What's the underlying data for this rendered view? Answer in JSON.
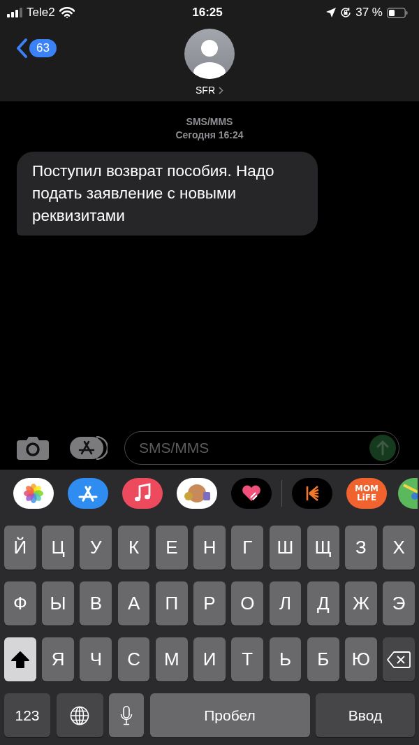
{
  "status_bar": {
    "carrier": "Tele2",
    "time": "16:25",
    "battery_percent": "37 %"
  },
  "header": {
    "back_count": "63",
    "contact_name": "SFR"
  },
  "conversation": {
    "service_label": "SMS/MMS",
    "timestamp": "Сегодня 16:24",
    "messages": [
      {
        "kind": "incoming",
        "text": "Поступил возврат пособия. Надо подать заявление с новыми реквизитами"
      }
    ]
  },
  "composer": {
    "placeholder": "SMS/MMS"
  },
  "app_strip": [
    {
      "kind": "photos"
    },
    {
      "kind": "appstore"
    },
    {
      "kind": "music"
    },
    {
      "kind": "stickers"
    },
    {
      "kind": "heart"
    },
    {
      "kind": "divider"
    },
    {
      "kind": "fan"
    },
    {
      "kind": "logo",
      "label": "MOM LiFE"
    },
    {
      "kind": "maps"
    }
  ],
  "keyboard": {
    "letter_rows": [
      [
        {
          "kind": "letter",
          "label": "Й"
        },
        {
          "kind": "letter",
          "label": "Ц"
        },
        {
          "kind": "letter",
          "label": "У"
        },
        {
          "kind": "letter",
          "label": "К"
        },
        {
          "kind": "letter",
          "label": "Е"
        },
        {
          "kind": "letter",
          "label": "Н"
        },
        {
          "kind": "letter",
          "label": "Г"
        },
        {
          "kind": "letter",
          "label": "Ш"
        },
        {
          "kind": "letter",
          "label": "Щ"
        },
        {
          "kind": "letter",
          "label": "З"
        },
        {
          "kind": "letter",
          "label": "Х"
        }
      ],
      [
        {
          "kind": "letter",
          "label": "Ф"
        },
        {
          "kind": "letter",
          "label": "Ы"
        },
        {
          "kind": "letter",
          "label": "В"
        },
        {
          "kind": "letter",
          "label": "А"
        },
        {
          "kind": "letter",
          "label": "П"
        },
        {
          "kind": "letter",
          "label": "Р"
        },
        {
          "kind": "letter",
          "label": "О"
        },
        {
          "kind": "letter",
          "label": "Л"
        },
        {
          "kind": "letter",
          "label": "Д"
        },
        {
          "kind": "letter",
          "label": "Ж"
        },
        {
          "kind": "letter",
          "label": "Э"
        }
      ],
      [
        {
          "kind": "shift",
          "on": true
        },
        {
          "kind": "letter",
          "label": "Я"
        },
        {
          "kind": "letter",
          "label": "Ч"
        },
        {
          "kind": "letter",
          "label": "С"
        },
        {
          "kind": "letter",
          "label": "М"
        },
        {
          "kind": "letter",
          "label": "И"
        },
        {
          "kind": "letter",
          "label": "Т"
        },
        {
          "kind": "letter",
          "label": "Ь"
        },
        {
          "kind": "letter",
          "label": "Б"
        },
        {
          "kind": "letter",
          "label": "Ю"
        },
        {
          "kind": "backspace"
        }
      ]
    ],
    "bottom_row": [
      {
        "kind": "numbers",
        "label": "123"
      },
      {
        "kind": "globe"
      },
      {
        "kind": "mic"
      },
      {
        "kind": "space",
        "label": "Пробел"
      },
      {
        "kind": "return",
        "label": "Ввод"
      }
    ]
  }
}
